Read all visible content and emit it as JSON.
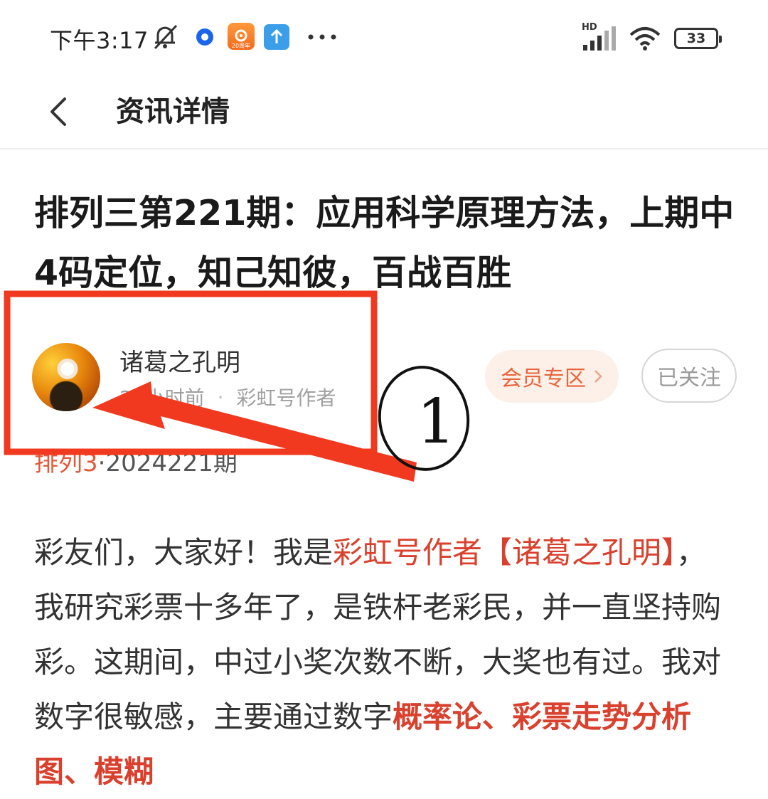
{
  "status_bar": {
    "time": "下午3:17",
    "app_icon_label": "20周年",
    "network": "HD",
    "battery": "33"
  },
  "nav": {
    "title": "资讯详情"
  },
  "article": {
    "title": "排列三第221期：应用科学原理方法，上期中4码定位，知己知彼，百战百胜",
    "author_name": "诸葛之孔明",
    "time_ago": "22小时前",
    "author_badge": "彩虹号作者",
    "vip_label": "会员专区",
    "follow_label": "已关注",
    "tag_link": "排列3",
    "tag_rest": "·2024221期",
    "body": {
      "p1": "彩友们，大家好！我是",
      "p1_hl": "彩虹号作者【诸葛之孔明】",
      "p2": "，我研究彩票十多年了，是铁杆老彩民，并一直坚持购彩。这期间，中过小奖次数不断，大奖也有过。我对数字很敏感，主要通过数字",
      "p2_hl1": "概率论",
      "p2_sep1": "、",
      "p2_hl2": "彩票走势分析图",
      "p2_sep2": "、",
      "p2_hl3": "模糊"
    }
  },
  "annotation": {
    "circle_label": "1"
  },
  "colors": {
    "accent": "#d9402d",
    "annotation_red": "#f0391f",
    "vip_bg": "#fdf0e8",
    "vip_text": "#e8643c"
  }
}
